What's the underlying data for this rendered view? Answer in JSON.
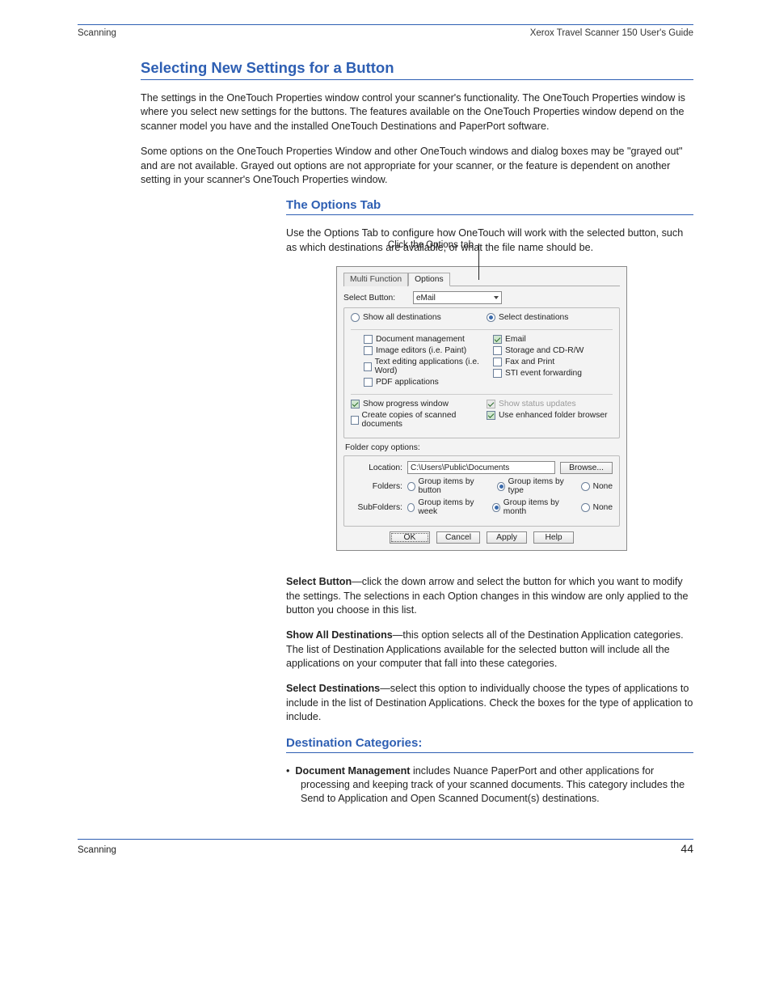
{
  "header": {
    "left": "Scanning",
    "right": "Xerox Travel Scanner 150 User's Guide"
  },
  "sections": {
    "h1": "Selecting New Settings for a Button",
    "p1": "The settings in the OneTouch Properties window control your scanner's functionality. The OneTouch Properties window is where you select new settings for the buttons. The features available on the OneTouch Properties window depend on the scanner model you have and the installed OneTouch Destinations and PaperPort software.",
    "p2": "Some options on the OneTouch Properties Window and other OneTouch windows and dialog boxes may be \"grayed out\" and are not available. Grayed out options are not appropriate for your scanner, or the feature is dependent on another setting in your scanner's OneTouch Properties window.",
    "h2a": "The Options Tab",
    "body2a_p1": "Use the Options Tab to configure how OneTouch will work with the selected button, such as which destinations are available, or what the file name should be.",
    "callout": "Click the Options tab",
    "body2a_p2_bold": "Select Button",
    "body2a_p2": "—click the down arrow and select the button for which you want to modify the settings. The selections in each Option changes in this window are only applied to the button you choose in this list.",
    "body2a_p3_bold": "Show All Destinations",
    "body2a_p3": "—this option selects all of the Destination Application categories. The list of Destination Applications available for the selected button will include all the applications on your computer that fall into these categories.",
    "body2a_p4_bold": "Select Destinations",
    "body2a_p4": "—select this option to individually choose the types of applications to include in the list of Destination Applications. Check the boxes for the type of application to include.",
    "h2b": "Destination Categories:",
    "bullets": [
      {
        "bold": "Document Management",
        "rest": " includes Nuance PaperPort and other applications for processing and keeping track of your scanned documents. This category includes the Send to Application and Open Scanned Document(s) destinations."
      }
    ]
  },
  "dialog": {
    "tabs": {
      "multifunction": "Multi Function",
      "options": "Options"
    },
    "selectButtonLabel": "Select Button:",
    "selectButtonValue": "eMail",
    "radios": {
      "showAll": "Show all destinations",
      "selectDest": "Select destinations"
    },
    "catsLeft": {
      "docmgmt": "Document management",
      "imgedit": "Image editors (i.e. Paint)",
      "textedit": "Text editing applications (i.e. Word)",
      "pdf": "PDF applications"
    },
    "catsRight": {
      "email": "Email",
      "storage": "Storage and CD-R/W",
      "fax": "Fax and Print",
      "sti": "STI event forwarding"
    },
    "lowerLeft": {
      "progress": "Show progress window",
      "copies": "Create copies of scanned documents"
    },
    "lowerRight": {
      "status": "Show status updates",
      "enhanced": "Use enhanced folder browser"
    },
    "folderCopy": {
      "title": "Folder copy options:",
      "locationLabel": "Location:",
      "locationValue": "C:\\Users\\Public\\Documents",
      "browse": "Browse...",
      "foldersLabel": "Folders:",
      "folders": {
        "byButton": "Group items by button",
        "byType": "Group items by type",
        "none": "None"
      },
      "subFoldersLabel": "SubFolders:",
      "subFolders": {
        "byWeek": "Group items by week",
        "byMonth": "Group items by month",
        "none": "None"
      }
    },
    "buttons": {
      "ok": "OK",
      "cancel": "Cancel",
      "apply": "Apply",
      "help": "Help"
    }
  },
  "footer": {
    "left": "Scanning",
    "page": "44"
  }
}
